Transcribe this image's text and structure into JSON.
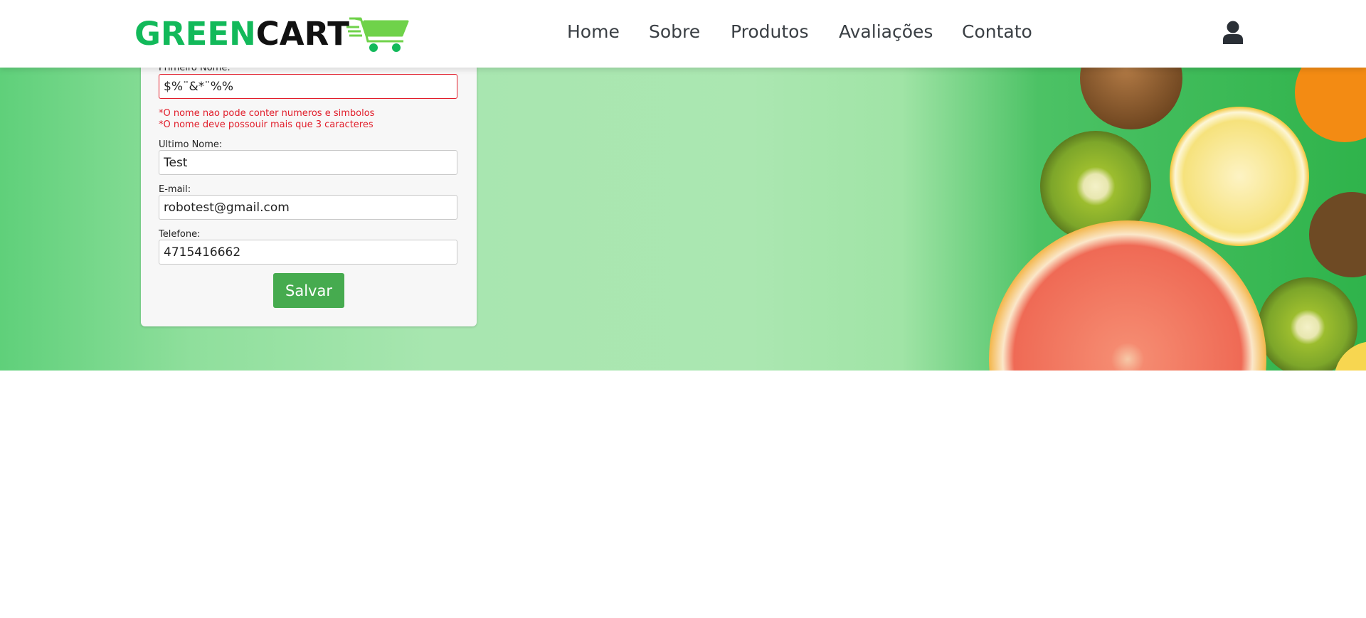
{
  "header": {
    "logo": {
      "part1": "GREEN",
      "part2": "CART",
      "icon": "shopping-cart-icon"
    },
    "nav": [
      {
        "label": "Home"
      },
      {
        "label": "Sobre"
      },
      {
        "label": "Produtos"
      },
      {
        "label": "Avaliações"
      },
      {
        "label": "Contato"
      }
    ],
    "user_icon": "user-icon"
  },
  "form": {
    "first_name": {
      "label": "Primeiro Nome:",
      "value": "$%¨&*¨%%",
      "errors": [
        "*O nome nao pode conter numeros e simbolos",
        "*O nome deve possouir mais que 3 caracteres"
      ]
    },
    "last_name": {
      "label": "Ultimo Nome:",
      "value": "Test"
    },
    "email": {
      "label": "E-mail:",
      "value": "robotest@gmail.com"
    },
    "phone": {
      "label": "Telefone:",
      "value": "4715416662"
    },
    "save_label": "Salvar"
  },
  "colors": {
    "brand_green": "#12b95a",
    "error_red": "#e11d2a",
    "button_green": "#46ab4f"
  }
}
